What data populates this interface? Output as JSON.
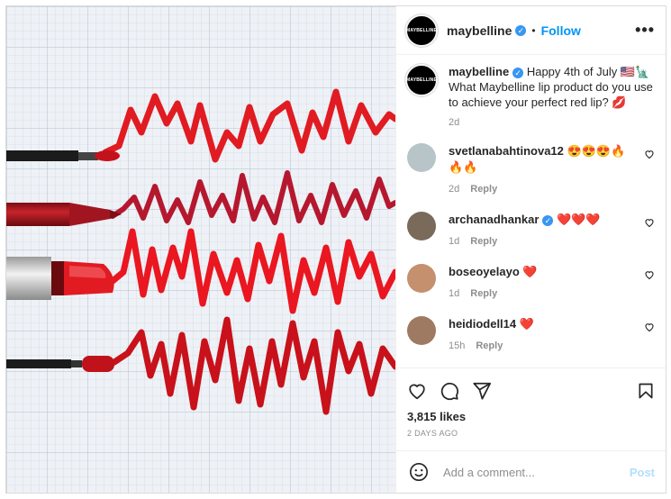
{
  "post": {
    "author": "maybelline",
    "follow_label": "Follow",
    "more_label": "•••",
    "avatar_text": "MAYBELLINE",
    "caption_text": "Happy 4th of July 🇺🇸🗽 What Maybelline lip product do you use to achieve your perfect red lip? 💋",
    "caption_time": "2d",
    "likes": "3,815 likes",
    "date": "2 DAYS AGO"
  },
  "comments": [
    {
      "user": "svetlanabahtinova12",
      "text": "😍😍😍🔥🔥🔥",
      "time": "2d",
      "reply": "Reply",
      "verified": false,
      "avatar_color": "#b7c4c8"
    },
    {
      "user": "archanadhankar",
      "text": "❤️❤️❤️",
      "time": "1d",
      "reply": "Reply",
      "verified": true,
      "avatar_color": "#7a6a5a"
    },
    {
      "user": "boseoyelayo",
      "text": "❤️",
      "time": "1d",
      "reply": "Reply",
      "verified": false,
      "avatar_color": "#c4906e"
    },
    {
      "user": "heidiodell14",
      "text": "❤️",
      "time": "15h",
      "reply": "Reply",
      "verified": false,
      "avatar_color": "#9e7a62"
    }
  ],
  "add_comment": {
    "placeholder": "Add a comment...",
    "post_label": "Post"
  },
  "colors": {
    "accent": "#0095f6",
    "verified": "#3897f0",
    "lipstick_red": "#d4141c"
  }
}
